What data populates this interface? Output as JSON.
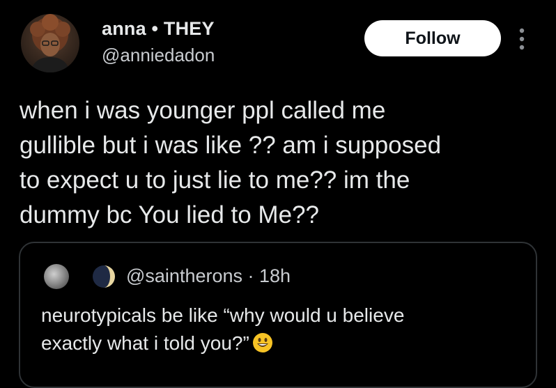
{
  "author": {
    "display_name": "anna • THEY",
    "handle": "@anniedadon"
  },
  "actions": {
    "follow_label": "Follow"
  },
  "tweet": {
    "lines": [
      "when i was younger ppl called me",
      "gullible but i was like ?? am i supposed",
      "to expect u to just lie to me?? im the",
      "dummy bc You lied to Me??"
    ]
  },
  "quote": {
    "meta": "@saintherons · 18h",
    "lines": [
      "neurotypicals be like “why would u believe",
      "exactly what i told you?”"
    ],
    "emoji": "grinning-face-emoji"
  },
  "colors": {
    "background": "#000000",
    "text_primary": "#e7e9ea",
    "text_secondary": "#c9ccd0",
    "follow_bg": "#ffffff",
    "border": "#2f3336"
  }
}
